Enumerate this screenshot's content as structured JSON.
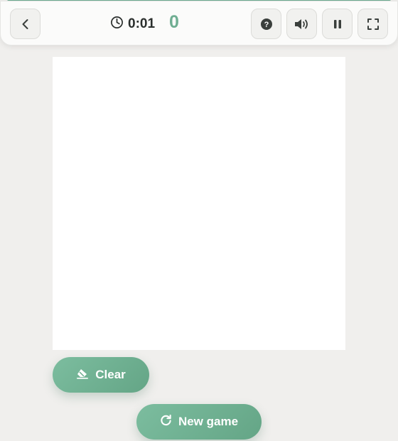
{
  "game": {
    "timer": "0:01",
    "score": "0",
    "progress_fraction": 1.0
  },
  "toolbar": {
    "back_icon": "chevron-left-icon",
    "help_icon": "help-circle-icon",
    "sound_icon": "volume-icon",
    "pause_icon": "pause-icon",
    "fullscreen_icon": "fullscreen-icon"
  },
  "actions": {
    "clear_label": "Clear",
    "new_game_label": "New game"
  },
  "colors": {
    "accent": "#6fae92",
    "button_green": "#6fae92",
    "background": "#f0efed",
    "canvas": "#ffffff"
  }
}
